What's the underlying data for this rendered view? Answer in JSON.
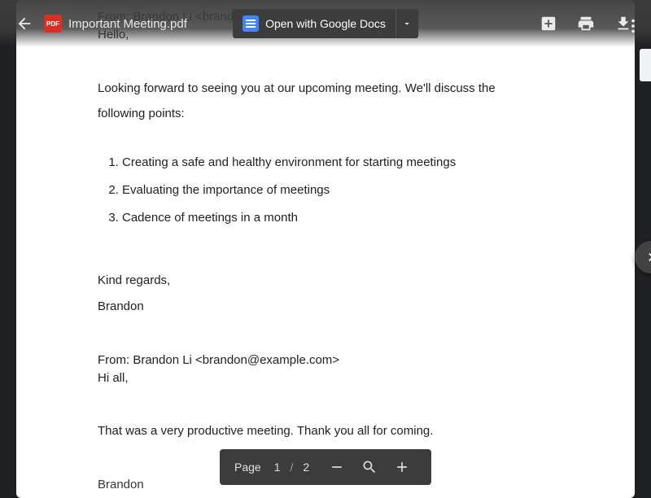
{
  "header": {
    "pdf_badge": "PDF",
    "filename": "Important Meeting.pdf",
    "open_with_label": "Open with Google Docs"
  },
  "doc": {
    "from1": "From: Brandon Li <brandon@example.com>",
    "hello": "Hello,",
    "intro1": "Looking forward to seeing you at our upcoming meeting. We'll discuss the",
    "intro2": "following points:",
    "points": {
      "p1": "Creating a safe and healthy environment for starting meetings",
      "p2": "Evaluating the importance of meetings",
      "p3": "Cadence of meetings in a month"
    },
    "regards": "Kind regards,",
    "sig1": "Brandon",
    "from2": "From: Brandon Li <brandon@example.com>",
    "hi_all": "Hi all,",
    "thanks": "That was a very productive meeting. Thank you all for coming.",
    "sig2_partial": "Brandon"
  },
  "pagebar": {
    "label": "Page",
    "current": "1",
    "separator": "/",
    "total": "2"
  }
}
